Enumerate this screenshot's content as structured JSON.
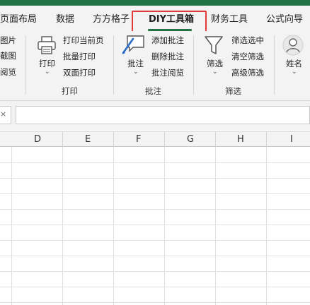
{
  "colors": {
    "brand": "#217346",
    "highlight": "#e03a3a",
    "ribbon_bg": "#f3f3f3",
    "gridline": "#e1e1e1"
  },
  "tabs": [
    {
      "label": "页面布局"
    },
    {
      "label": "数据"
    },
    {
      "label": "方方格子"
    },
    {
      "label": "DIY工具箱",
      "active": true
    },
    {
      "label": "财务工具"
    },
    {
      "label": "公式向导"
    }
  ],
  "ribbon": {
    "left_partial": {
      "item1": "图片",
      "item2": "截图",
      "item3": "阅览"
    },
    "print_group": {
      "big_button_label": "打印",
      "items": [
        "打印当前页",
        "批量打印",
        "双面打印"
      ],
      "label": "打印"
    },
    "comment_group": {
      "big_button_label": "批注",
      "items": [
        "添加批注",
        "删除批注",
        "批注阅览"
      ],
      "label": "批注"
    },
    "filter_group": {
      "big_button_label": "筛选",
      "items": [
        "筛选选中",
        "清空筛选",
        "高级筛选"
      ],
      "label": "筛选"
    },
    "name_group": {
      "big_button_label": "姓名"
    }
  },
  "formula_bar": {
    "name_box_value": "",
    "formula_value": ""
  },
  "columns": [
    "D",
    "E",
    "F",
    "G",
    "H",
    "I"
  ]
}
